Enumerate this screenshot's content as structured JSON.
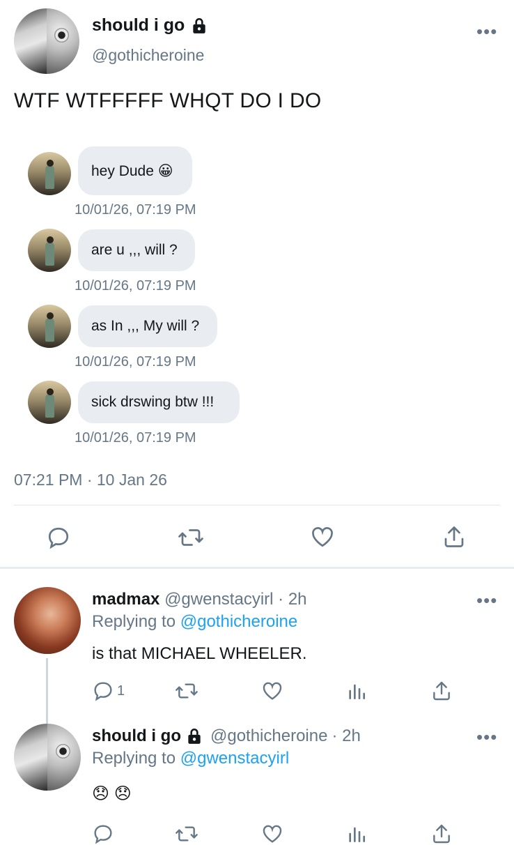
{
  "tweet": {
    "display_name": "should i go",
    "handle": "@gothicheroine",
    "text": "WTF WTFFFFF WHQT DO I DO",
    "timestamp": "07:21 PM · 10 Jan 26",
    "messages": [
      {
        "text": "hey Dude 😀",
        "time": "10/01/26, 07:19 PM"
      },
      {
        "text": "are u ,,, will ?",
        "time": "10/01/26, 07:19 PM"
      },
      {
        "text": "as In ,,, My will ?",
        "time": "10/01/26, 07:19 PM"
      },
      {
        "text": "sick drswing btw !!!",
        "time": "10/01/26, 07:19 PM"
      }
    ]
  },
  "replies": [
    {
      "display_name": "madmax",
      "handle": "@gwenstacyirl",
      "age": "· 2h",
      "replying_prefix": "Replying to",
      "replying_to": "@gothicheroine",
      "text": "is that MICHAEL WHEELER.",
      "reply_count": "1"
    },
    {
      "display_name": "should i go",
      "handle": "@gothicheroine",
      "age": "· 2h",
      "replying_prefix": "Replying to",
      "replying_to": "@gwenstacyirl",
      "text": "😞 😞"
    }
  ],
  "menu_glyph": "•••",
  "icons": [
    "lock-icon",
    "reply-icon",
    "retweet-icon",
    "like-icon",
    "share-icon",
    "analytics-icon",
    "more-icon"
  ],
  "colors": {
    "link": "#1da1f2",
    "secondary": "#657786",
    "bubble": "#e9edf1",
    "divider": "#e1e8ed"
  }
}
